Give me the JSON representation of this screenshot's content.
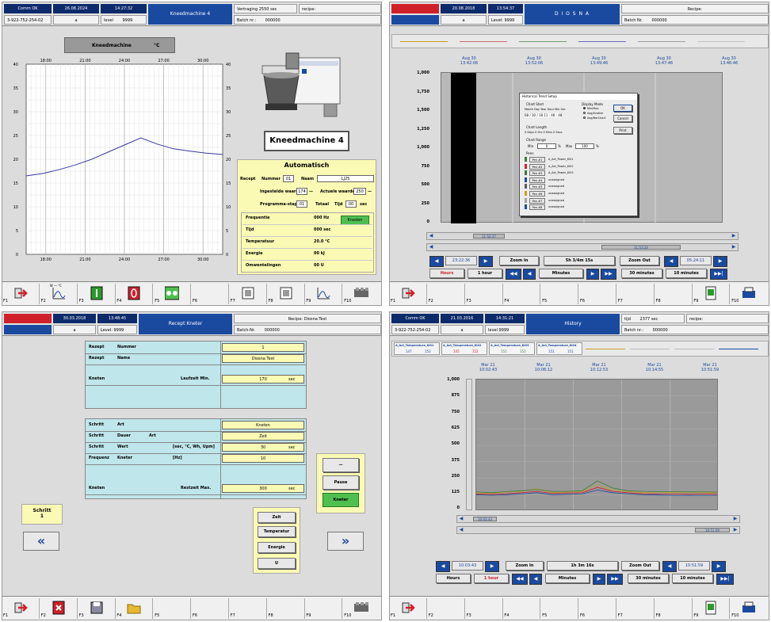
{
  "tl": {
    "header": {
      "status": "Comm OK",
      "date": "26.08.2024",
      "time": "14:27:32",
      "id": "3-922-752-254-02",
      "field_a": "a",
      "level_label": "level",
      "level_value": "9999",
      "title": "Kneedmachine 4",
      "vertraging_label": "Vertraging",
      "vertraging_value": "2550 sec",
      "recipe_label": "recipe:",
      "batch_label": "Batch nr.:",
      "batch_value": "000000"
    },
    "chart_title": "Kneedmachine",
    "chart_unit": "°C",
    "chart_data": {
      "type": "line",
      "x_ticks": [
        "18:00",
        "21:00",
        "24:00",
        "27:00",
        "30:00"
      ],
      "y_ticks": [
        "40",
        "35",
        "30",
        "25",
        "20",
        "15",
        "10",
        "5",
        "0"
      ],
      "ylim": [
        0,
        40
      ],
      "series": [
        {
          "values": [
            16.5,
            17,
            17.8,
            18.8,
            20,
            21.5,
            23,
            24.5,
            23.2,
            22.2,
            21.7,
            21.3,
            21.0
          ]
        }
      ],
      "line_color": "#3a3aa0"
    },
    "machine_label": "Kneedmachine 4",
    "auto": {
      "title": "Automatisch",
      "recept_label": "Recept",
      "nummer_label": "Nummer",
      "nummer_value": "01",
      "naam_label": "Naam",
      "naam_value": "LJ25",
      "ingestelde_label": "Ingestelde waarde",
      "ingestelde_value": "174",
      "actuele_label": "Actuele waarde",
      "actuele_value": "250",
      "programma_label": "Programma-stap",
      "programma_value": "01",
      "totaal_label": "Totaal",
      "tijd_label": "Tijd",
      "tijd_value": "00",
      "sec": "sec",
      "dash": "—",
      "rows": [
        {
          "label": "Frequentie",
          "value": "000 Hz"
        },
        {
          "label": "Tijd",
          "value": "000 sec"
        },
        {
          "label": "Temperatuur",
          "value": "20.0 °C"
        },
        {
          "label": "Energie",
          "value": "00 kJ"
        },
        {
          "label": "Omwentelingen",
          "value": "00 U"
        }
      ],
      "green": "Kneden"
    },
    "fkeys": [
      "F1",
      "F2",
      "F3",
      "F4",
      "F5",
      "F6",
      "F7",
      "F8",
      "F9",
      "F10"
    ],
    "f2_text": "W — °C"
  },
  "tr": {
    "header": {
      "date": "20.08.2018",
      "time": "13:54:37",
      "title": "D I O S N A",
      "recipe_label": "Recipe:",
      "batch_label": "Batch Nr.",
      "batch_value": "000000",
      "field_a": "a",
      "level_label": "Level:",
      "level_value": "9999"
    },
    "date_ticks": [
      "Aug 30\n13:42:06",
      "Aug 30\n13:52:06",
      "Aug 30\n13:49:46",
      "Aug 30\n13:47:46",
      "Aug 30\n13:46:46"
    ],
    "y_ticks": [
      "1,000",
      "1,750",
      "1,500",
      "1,250",
      "1,000",
      "750",
      "500",
      "250",
      "0"
    ],
    "dialog": {
      "title": "Historical Trend Setup",
      "start_label": "Chart Start",
      "start_fields": "Month  Day  Year  Hour  Min  Sec",
      "start_values": "08 / 30 / 18   11 : 46 : 48",
      "display_label": "Display Mode",
      "modes": [
        "Min/Max",
        "Avg/Scatter",
        "Avg/BarChart"
      ],
      "ok": "OK",
      "cancel": "Cancel",
      "print": "Print",
      "length_label": "Chart Length",
      "length_values": "0  Days  0  Hrs  0  Mins  0  Secs",
      "range_label": "Chart Range",
      "min_label": "Min",
      "min_value": "0",
      "max_label": "Max",
      "max_value": "100",
      "pct": "%",
      "pens_label": "Pens",
      "pens": [
        {
          "btn": "Pen #1",
          "name": "A_Act_Power_Kl01",
          "color": "#3b7a3b"
        },
        {
          "btn": "Pen #2",
          "name": "A_Act_Power_Kl02",
          "color": "#d0202a"
        },
        {
          "btn": "Pen #3",
          "name": "A_Act_Power_Kl03",
          "color": "#3b7a3b"
        },
        {
          "btn": "Pen #4",
          "name": "unassigned",
          "color": "#1a4aa0"
        },
        {
          "btn": "Pen #5",
          "name": "unassigned",
          "color": "#5a5a5a"
        },
        {
          "btn": "Pen #6",
          "name": "unassigned",
          "color": "#c9a020"
        },
        {
          "btn": "Pen #7",
          "name": "unassigned",
          "color": "#a0a0a0"
        },
        {
          "btn": "Pen #8",
          "name": "unassigned",
          "color": "#1a4aa0"
        }
      ]
    },
    "scroll1": "11:52:37",
    "scroll2": "11:53:24",
    "nav": {
      "left_time": "23:22:36",
      "zoom_in": "Zoom In",
      "span": "5h 3/4m 15s",
      "zoom_out": "Zoom Out",
      "right_time": "05:24:11",
      "hours": "Hours",
      "one_hour": "1 hour",
      "minutes": "Minutes",
      "thirty": "30 minutes",
      "ten": "10 minutes"
    },
    "fkeys": [
      "F1",
      "F2",
      "F3",
      "F4",
      "F5",
      "F6",
      "F7",
      "F8",
      "F9",
      "F10"
    ]
  },
  "bl": {
    "header": {
      "date": "30.03.2018",
      "time": "13:48:45",
      "title": "Recept Kneter",
      "recipe_label": "Recipe: Diosna Test",
      "batch_label": "Batch-Nr.",
      "batch_value": "000000",
      "field_a": "a",
      "level_label": "Level:",
      "level_value": "9999"
    },
    "top_rows": [
      {
        "a": "Rezept",
        "b": "Nummer",
        "value": "1"
      },
      {
        "a": "Rezept",
        "b": "Name",
        "value": "Diosna Test"
      },
      {
        "a": "Kneten",
        "b": "Laufzeit Min.",
        "value": "170",
        "unit": "sec"
      }
    ],
    "mid_rows": [
      {
        "a": "Schritt",
        "b": "Art",
        "c": "",
        "value": "Kneten"
      },
      {
        "a": "Schritt",
        "b": "Dauer",
        "c": "Art",
        "value": "Zeit"
      },
      {
        "a": "Schritt",
        "b": "Wert",
        "c": "[sec, °C, Wh, Upm]",
        "value": "30",
        "unit": "sec"
      },
      {
        "a": "Frequenz",
        "b": "Kneter",
        "c": "[Hz]",
        "value": "10"
      },
      {
        "a": "Kneten",
        "b": "Restzeit Max.",
        "value": "300",
        "unit": "sec"
      }
    ],
    "side_btns": [
      "—",
      "Pause",
      "Kneter"
    ],
    "schritt_label": "Schritt",
    "schritt_value": "1",
    "mode_btns": [
      "Zeit",
      "Temperatur",
      "Energie",
      "U"
    ],
    "fkeys": [
      "F1",
      "F2",
      "F3",
      "F4",
      "F5",
      "F6",
      "F7",
      "F8",
      "F9",
      "F10"
    ]
  },
  "br": {
    "header": {
      "status": "Comm OK",
      "date": "21.03.2016",
      "time": "14:31:21",
      "id": "3-922-752-254-02",
      "field_a": "a",
      "level_label": "level",
      "level_value": "9999",
      "title": "History",
      "tijd_label": "tijd",
      "tijd_value": "2377 sec",
      "recipe_label": "recipe:",
      "batch_label": "Batch nr.:",
      "batch_value": "000000"
    },
    "pens": [
      {
        "name": "A_Act_Temperature_Kl01",
        "v1": "147",
        "v2": "152",
        "color": "#1a4aa0"
      },
      {
        "name": "A_Act_Temperature_Kl02",
        "v1": "145",
        "v2": "152",
        "color": "#d0202a"
      },
      {
        "name": "A_Act_Temperature_Kl03",
        "v1": "151",
        "v2": "152",
        "color": "#3b7a3b"
      },
      {
        "name": "A_Act_Temperature_Kl04",
        "v1": "151",
        "v2": "151",
        "color": "#1a4aa0"
      }
    ],
    "date_ticks": [
      "Mar 21\n10:02:43",
      "Mar 21\n10:06:12",
      "Mar 21\n10:12:53",
      "Mar 21\n10:14:55",
      "Mar 21\n10:51:59"
    ],
    "y_ticks": [
      "1,000",
      "875",
      "750",
      "625",
      "500",
      "375",
      "250",
      "125",
      "0"
    ],
    "chart_data": {
      "type": "line",
      "ylim": [
        0,
        1000
      ],
      "series": [
        {
          "color": "#c9a020",
          "values": [
            140,
            135,
            145,
            150,
            170,
            140,
            145,
            150,
            200,
            160,
            150,
            140,
            145,
            140,
            142,
            140,
            138
          ]
        },
        {
          "color": "#d0202a",
          "values": [
            130,
            128,
            132,
            140,
            150,
            135,
            138,
            140,
            180,
            150,
            140,
            132,
            130,
            130,
            128,
            130,
            128
          ]
        },
        {
          "color": "#3b7a3b",
          "values": [
            145,
            140,
            148,
            155,
            165,
            150,
            150,
            155,
            230,
            175,
            155,
            150,
            148,
            147,
            146,
            145,
            144
          ]
        },
        {
          "color": "#1a4aa0",
          "values": [
            125,
            120,
            125,
            130,
            140,
            125,
            128,
            130,
            160,
            140,
            130,
            125,
            122,
            120,
            120,
            120,
            120
          ]
        }
      ]
    },
    "scroll1": "10:03:43",
    "scroll2": "10:51:59",
    "nav": {
      "left_time": "10:03:43",
      "zoom_in": "Zoom In",
      "span": "1h 3m 16s",
      "zoom_out": "Zoom Out",
      "right_time": "10:51:59",
      "hours": "Hours",
      "one_hour": "1 hour",
      "minutes": "Minutes",
      "thirty": "30 minutes",
      "ten": "10 minutes"
    },
    "fkeys": [
      "F1",
      "F2",
      "F3",
      "F4",
      "F5",
      "F6",
      "F7",
      "F8",
      "F9",
      "F10"
    ]
  }
}
